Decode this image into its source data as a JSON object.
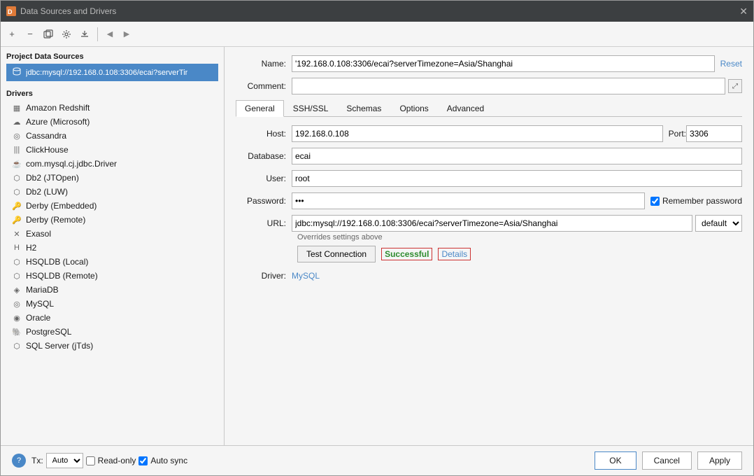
{
  "window": {
    "title": "Data Sources and Drivers",
    "icon_label": "DS"
  },
  "toolbar": {
    "add_btn": "+",
    "remove_btn": "−",
    "copy_btn": "⧉",
    "config_btn": "⚙",
    "move_btn": "↗",
    "back_btn": "←",
    "fwd_btn": "→"
  },
  "left_panel": {
    "project_section_title": "Project Data Sources",
    "db_item_text": "jdbc:mysql://192.168.0.108:3306/ecai?serverTir",
    "drivers_section_title": "Drivers",
    "drivers": [
      {
        "icon": "▦",
        "label": "Amazon Redshift"
      },
      {
        "icon": "☁",
        "label": "Azure (Microsoft)"
      },
      {
        "icon": "◎",
        "label": "Cassandra"
      },
      {
        "icon": "|||",
        "label": "ClickHouse"
      },
      {
        "icon": "☕",
        "label": "com.mysql.cj.jdbc.Driver"
      },
      {
        "icon": "⬡",
        "label": "Db2 (JTOpen)"
      },
      {
        "icon": "⬡",
        "label": "Db2 (LUW)"
      },
      {
        "icon": "🔑",
        "label": "Derby (Embedded)"
      },
      {
        "icon": "🔑",
        "label": "Derby (Remote)"
      },
      {
        "icon": "✕",
        "label": "Exasol"
      },
      {
        "icon": "H",
        "label": "H2"
      },
      {
        "icon": "⬡",
        "label": "HSQLDB (Local)"
      },
      {
        "icon": "⬡",
        "label": "HSQLDB (Remote)"
      },
      {
        "icon": "◈",
        "label": "MariaDB"
      },
      {
        "icon": "◎",
        "label": "MySQL"
      },
      {
        "icon": "◉",
        "label": "Oracle"
      },
      {
        "icon": "🐘",
        "label": "PostgreSQL"
      },
      {
        "icon": "⬡",
        "label": "SQL Server (jTds)"
      }
    ]
  },
  "right_panel": {
    "name_label": "Name:",
    "name_value": "'192.168.0.108:3306/ecai?serverTimezone=Asia/Shanghai",
    "reset_label": "Reset",
    "comment_label": "Comment:",
    "tabs": [
      "General",
      "SSH/SSL",
      "Schemas",
      "Options",
      "Advanced"
    ],
    "active_tab": "General",
    "host_label": "Host:",
    "host_value": "192.168.0.108",
    "port_label": "Port:",
    "port_value": "3306",
    "database_label": "Database:",
    "database_value": "ecai",
    "user_label": "User:",
    "user_value": "root",
    "password_label": "Password:",
    "password_value": "•••",
    "remember_password_label": "Remember password",
    "url_label": "URL:",
    "url_value": "jdbc:mysql://192.168.0.108:3306/ecai?serverTimezone=Asia/Shanghai",
    "url_scheme": "default",
    "overrides_text": "Overrides settings above",
    "test_btn_label": "Test Connection",
    "success_text": "Successful",
    "details_text": "Details",
    "driver_label": "Driver:",
    "driver_value": "MySQL"
  },
  "bottom_bar": {
    "tx_label": "Tx:",
    "tx_value": "Auto",
    "readonly_label": "Read-only",
    "autosync_label": "Auto sync",
    "ok_label": "OK",
    "cancel_label": "Cancel",
    "apply_label": "Apply",
    "help_label": "?"
  }
}
